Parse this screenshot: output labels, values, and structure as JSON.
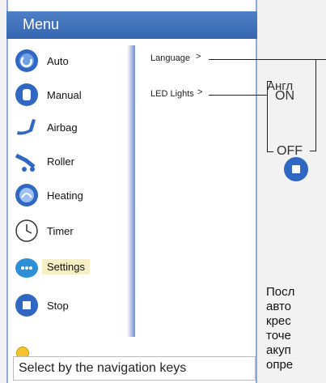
{
  "menu": {
    "title": "Menu",
    "items": [
      {
        "label": "Auto",
        "icon": "auto-icon"
      },
      {
        "label": "Manual",
        "icon": "manual-icon"
      },
      {
        "label": "Airbag",
        "icon": "airbag-icon"
      },
      {
        "label": "Roller",
        "icon": "roller-icon"
      },
      {
        "label": "Heating",
        "icon": "heating-icon"
      },
      {
        "label": "Timer",
        "icon": "timer-icon"
      },
      {
        "label": "Settings",
        "icon": "settings-icon",
        "selected": true
      },
      {
        "label": "Stop",
        "icon": "stop-icon"
      }
    ]
  },
  "settings": {
    "language": "Language",
    "led_lights": "LED Lights",
    "on": "ON",
    "off": "OFF",
    "language_value": "Англ"
  },
  "status": {
    "text": "Select by the navigation keys"
  },
  "annotation": {
    "lines": [
      "Посл",
      "авто",
      "крес",
      "точе",
      "акуп",
      "опре"
    ]
  },
  "colors": {
    "header_blue": "#3f73bd",
    "selected_bg": "#f6efc6",
    "accent": "#3d6fc2"
  }
}
